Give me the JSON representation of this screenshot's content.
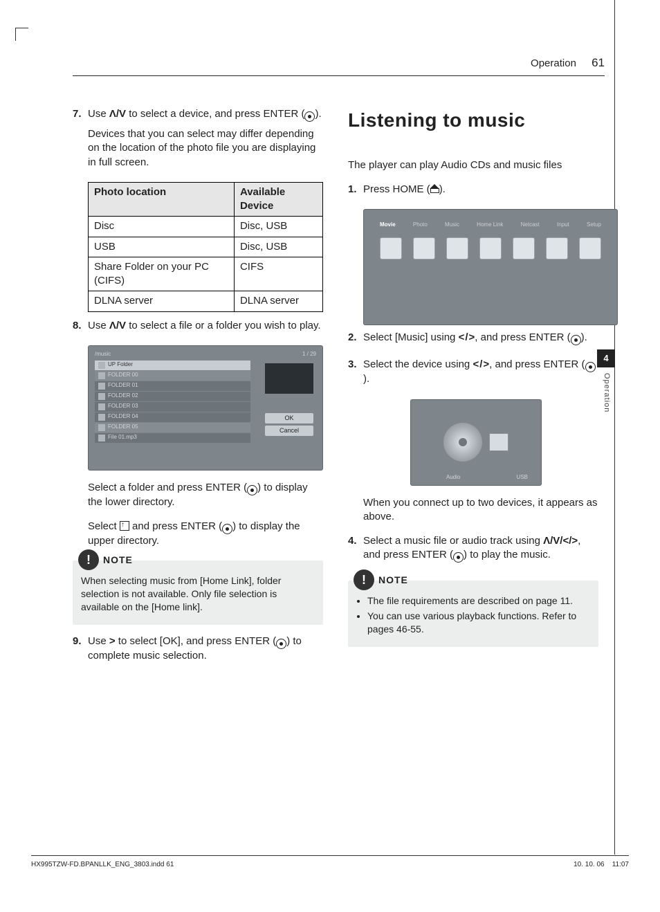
{
  "header": {
    "section": "Operation",
    "page": "61"
  },
  "left": {
    "step7": {
      "num": "7.",
      "text_a": "Use ",
      "arrows_ud": "Λ/V",
      "text_b": " to select a device, and press ENTER (",
      "text_c": ").",
      "para2": "Devices that you can select may differ depending on the location of the photo file you are displaying in full screen."
    },
    "table": {
      "h1": "Photo location",
      "h2": "Available Device",
      "rows": [
        {
          "a": "Disc",
          "b": "Disc, USB"
        },
        {
          "a": "USB",
          "b": "Disc, USB"
        },
        {
          "a": "Share Folder on your PC (CIFS)",
          "b": "CIFS"
        },
        {
          "a": "DLNA server",
          "b": "DLNA server"
        }
      ]
    },
    "step8": {
      "num": "8.",
      "text_a": "Use ",
      "arrows_ud": "Λ/V",
      "text_b": " to select a file or a folder you wish to play."
    },
    "folder_shot": {
      "path": "/music",
      "count": "1 / 29",
      "up": "UP Folder",
      "rows": [
        "FOLDER 00",
        "FOLDER 01",
        "FOLDER 02",
        "FOLDER 03",
        "FOLDER 04",
        "FOLDER 05",
        "File 01.mp3"
      ],
      "ok": "OK",
      "cancel": "Cancel"
    },
    "after_shot_1a": "Select a folder and press ENTER (",
    "after_shot_1b": ") to display the lower directory.",
    "after_shot_2a": "Select ",
    "after_shot_2b": " and press ENTER (",
    "after_shot_2c": ") to display the upper directory.",
    "note": {
      "title": "NOTE",
      "body": "When selecting music from [Home Link], folder selection is not available. Only file selection is available on the [Home link]."
    },
    "step9": {
      "num": "9.",
      "text_a": "Use ",
      "arrow_r": ">",
      "text_b": " to select [OK], and press ENTER (",
      "text_c": ") to complete music selection."
    }
  },
  "right": {
    "heading": "Listening to music",
    "intro": "The player can play Audio CDs and music files",
    "step1": {
      "num": "1.",
      "a": "Press HOME (",
      "b": ")."
    },
    "home_tabs": [
      "Movie",
      "Photo",
      "Music",
      "Home Link",
      "Netcast",
      "Input",
      "Setup"
    ],
    "step2": {
      "num": "2.",
      "a": "Select [Music] using ",
      "b": ", and press ENTER (",
      "c": ")."
    },
    "step3": {
      "num": "3.",
      "a": "Select the device using ",
      "b": ", and press ENTER (",
      "c": ")."
    },
    "device_labels": {
      "a": "Audio",
      "b": "USB"
    },
    "after_device": "When you connect up to two devices, it appears as above.",
    "step4": {
      "num": "4.",
      "a": "Select a music file or audio track using ",
      "arrows": "Λ/V/</>",
      "b": ", and press ENTER (",
      "c": ") to play the music."
    },
    "note": {
      "title": "NOTE",
      "items": [
        "The file requirements are described on page 11.",
        "You can use various playback functions. Refer to pages 46-55."
      ]
    }
  },
  "side": {
    "num": "4",
    "label": "Operation"
  },
  "footer": {
    "file": "HX995TZW-FD.BPANLLK_ENG_3803.indd   61",
    "date": "10. 10. 06",
    "time": "11:07"
  }
}
